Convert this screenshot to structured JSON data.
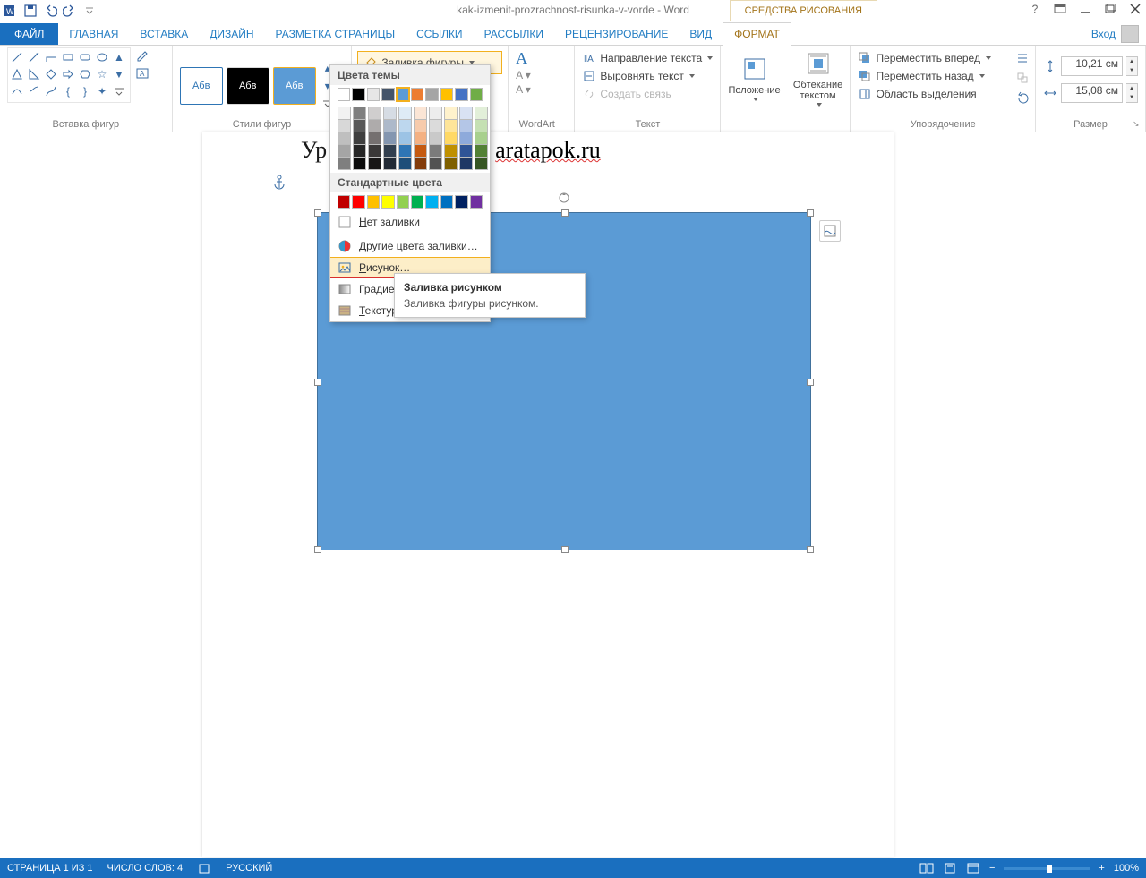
{
  "title": "kak-izmenit-prozrachnost-risunka-v-vorde - Word",
  "context_tab": "СРЕДСТВА РИСОВАНИЯ",
  "login": "Вход",
  "tabs": [
    "ФАЙЛ",
    "ГЛАВНАЯ",
    "ВСТАВКА",
    "ДИЗАЙН",
    "РАЗМЕТКА СТРАНИЦЫ",
    "ССЫЛКИ",
    "РАССЫЛКИ",
    "РЕЦЕНЗИРОВАНИЕ",
    "ВИД",
    "ФОРМАТ"
  ],
  "active_tab": "ФОРМАТ",
  "ribbon": {
    "shapes_group": "Вставка фигур",
    "styles_group": "Стили фигур",
    "wordart_group": "WordArt",
    "text_group": "Текст",
    "arrange_group": "Упорядочение",
    "size_group": "Размер",
    "style_thumbs": [
      "Абв",
      "Абв",
      "Абв"
    ],
    "fill_button": "Заливка фигуры",
    "text_dir": "Направление текста",
    "text_align": "Выровнять текст",
    "create_link": "Создать связь",
    "position": "Положение",
    "wrap": "Обтекание текстом",
    "bring_forward": "Переместить вперед",
    "send_backward": "Переместить назад",
    "selection_pane": "Область выделения",
    "height": "10,21 см",
    "width": "15,08 см"
  },
  "fill_menu": {
    "theme_header": "Цвета темы",
    "standard_header": "Стандартные цвета",
    "theme_row1": [
      "#ffffff",
      "#000000",
      "#e7e6e6",
      "#44546a",
      "#5b9bd5",
      "#ed7d31",
      "#a5a5a5",
      "#ffc000",
      "#4472c4",
      "#70ad47"
    ],
    "theme_shades": [
      [
        "#f2f2f2",
        "#7f7f7f",
        "#d0cece",
        "#d6dce4",
        "#deebf6",
        "#fbe5d5",
        "#ededed",
        "#fff2cc",
        "#d9e2f3",
        "#e2efd9"
      ],
      [
        "#d8d8d8",
        "#595959",
        "#aeabab",
        "#adb9ca",
        "#bdd7ee",
        "#f7cbac",
        "#dbdbdb",
        "#fee599",
        "#b4c6e7",
        "#c5e0b3"
      ],
      [
        "#bfbfbf",
        "#3f3f3f",
        "#757070",
        "#8496b0",
        "#9cc3e5",
        "#f4b183",
        "#c9c9c9",
        "#ffd965",
        "#8eaadb",
        "#a8d08d"
      ],
      [
        "#a5a5a5",
        "#262626",
        "#3a3838",
        "#323f4f",
        "#2e75b5",
        "#c55a11",
        "#7b7b7b",
        "#bf9000",
        "#2f5496",
        "#538135"
      ],
      [
        "#7f7f7f",
        "#0c0c0c",
        "#171616",
        "#222a35",
        "#1e4e79",
        "#833c0b",
        "#525252",
        "#7f6000",
        "#1f3864",
        "#375623"
      ]
    ],
    "standard_row": [
      "#c00000",
      "#ff0000",
      "#ffc000",
      "#ffff00",
      "#92d050",
      "#00b050",
      "#00b0f0",
      "#0070c0",
      "#002060",
      "#7030a0"
    ],
    "no_fill": "Нет заливки",
    "more_colors": "Другие цвета заливки…",
    "picture": "Рисунок…",
    "gradient": "Градиентная",
    "texture": "Текстура"
  },
  "tooltip": {
    "title": "Заливка рисунком",
    "body": "Заливка фигуры рисунком."
  },
  "document": {
    "visible_text_left": "Ур",
    "visible_text_right": "aratapok.ru"
  },
  "statusbar": {
    "page": "СТРАНИЦА 1 ИЗ 1",
    "words": "ЧИСЛО СЛОВ: 4",
    "lang": "РУССКИЙ",
    "zoom": "100%"
  }
}
